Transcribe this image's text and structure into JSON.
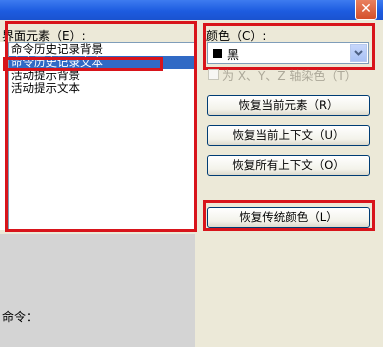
{
  "window": {
    "close_glyph": "✕"
  },
  "elements": {
    "label": "界面元素（E）:",
    "items": [
      "命令历史记录背景",
      "命令历史记录文本",
      "活动提示背景",
      "活动提示文本"
    ],
    "selected_index": 1
  },
  "color": {
    "label": "颜色（C）:",
    "value": "黑",
    "swatch": "#000000"
  },
  "tint": {
    "label": "为 X、Y、Z 轴染色（T）",
    "checked": false,
    "enabled": false
  },
  "buttons": {
    "restore_current_element": "恢复当前元素（R）",
    "restore_current_context": "恢复当前上下文（U）",
    "restore_all_contexts": "恢复所有上下文（O）",
    "restore_classic_colors": "恢复传统颜色（L）"
  },
  "preview": {
    "command_text": "命令："
  },
  "accent": {
    "highlight_red": "#d8141b",
    "selection_blue": "#316ac5"
  }
}
